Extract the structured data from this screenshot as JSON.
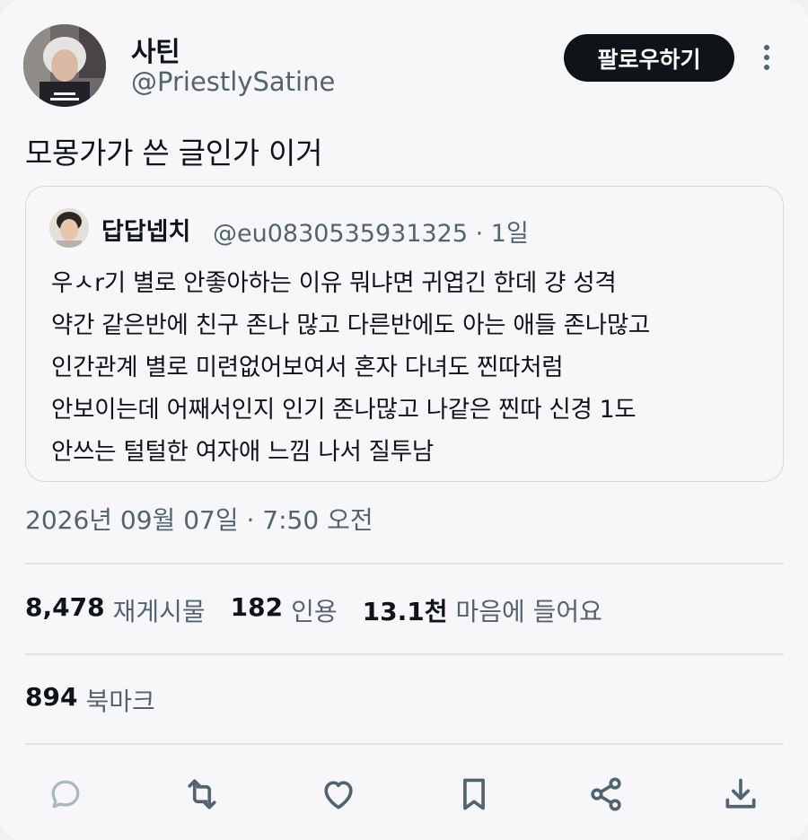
{
  "author": {
    "display_name": "사틴",
    "handle": "@PriestlySatine"
  },
  "follow_label": "팔로우하기",
  "tweet_text": "모몽가가 쓴 글인가 이거",
  "quote": {
    "display_name": "답답넵치",
    "meta": "@eu0830535931325 · 1일",
    "lines": [
      "우ㅅr기 별로 안좋아하는 이유 뭐냐면 귀엽긴 한데 걍 성격",
      "약간 같은반에 친구 존나 많고 다른반에도 아는 애들 존나많고",
      "인간관계 별로 미련없어보여서 혼자 다녀도 찐따처럼",
      "안보이는데 어째서인지 인기 존나많고 나같은 찐따 신경 1도",
      "안쓰는 털털한 여자애 느낌 나서 질투남"
    ]
  },
  "timestamp": "2026년 09월 07일 · 7:50 오전",
  "stats": {
    "retweets": {
      "value": "8,478",
      "label": "재게시물"
    },
    "quotes": {
      "value": "182",
      "label": "인용"
    },
    "likes": {
      "value": "13.1천",
      "label": "마음에 들어요"
    },
    "bookmarks": {
      "value": "894",
      "label": "북마크"
    }
  },
  "icons": {
    "more": "more-vertical-icon",
    "reply": "reply-icon",
    "retweet": "retweet-icon",
    "like": "heart-icon",
    "bookmark": "bookmark-icon",
    "share": "share-icon",
    "download": "download-icon"
  },
  "colors": {
    "background": "#f7f7f9",
    "text_primary": "#0f1419",
    "text_secondary": "#536471",
    "follow_button": "#0f1419",
    "border": "#cfd9de",
    "icon": "#536471",
    "reply_icon_muted": "#aab8c2"
  }
}
